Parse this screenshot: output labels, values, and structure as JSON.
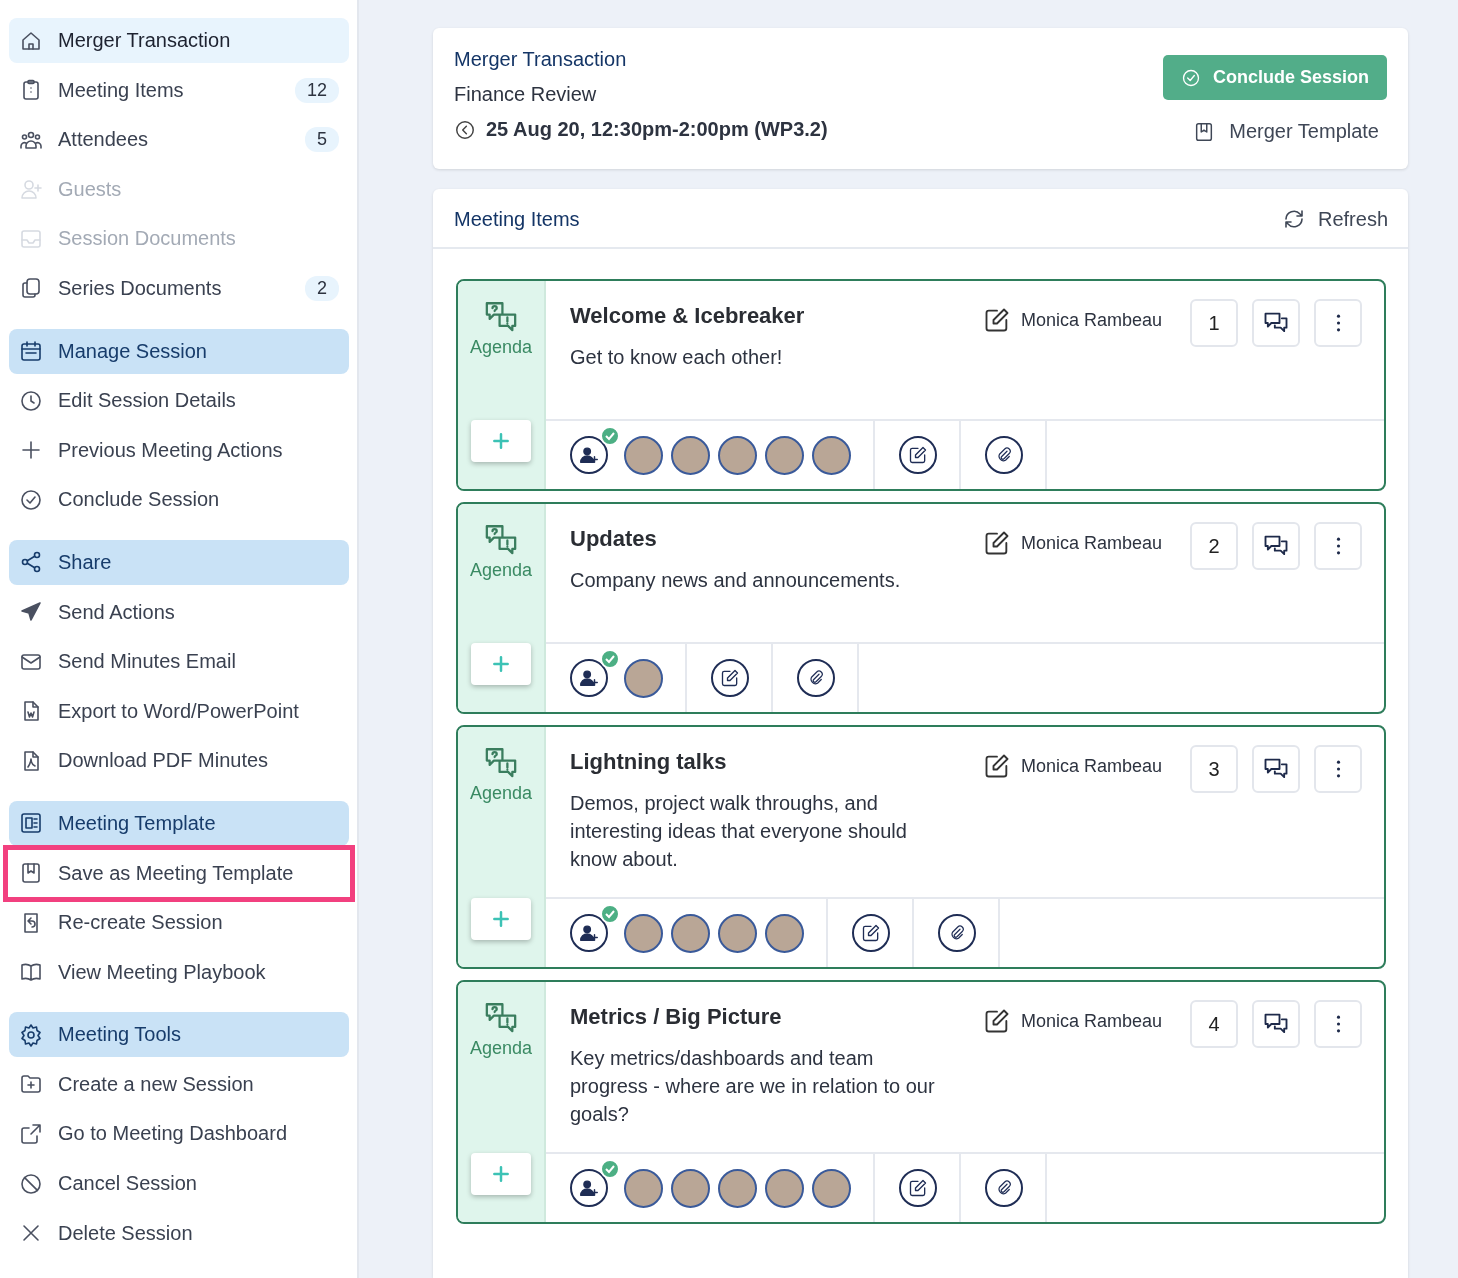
{
  "sidebar": {
    "items": [
      {
        "kind": "title",
        "label": "Merger Transaction",
        "highlighted": false
      },
      {
        "kind": "item",
        "label": "Meeting Items",
        "count": "12",
        "disabled": false,
        "highlighted": false
      },
      {
        "kind": "item",
        "label": "Attendees",
        "count": "5",
        "disabled": false,
        "highlighted": false
      },
      {
        "kind": "item",
        "label": "Guests",
        "disabled": true,
        "highlighted": false
      },
      {
        "kind": "item",
        "label": "Session Documents",
        "disabled": true,
        "highlighted": false
      },
      {
        "kind": "item",
        "label": "Series Documents",
        "count": "2",
        "disabled": false,
        "highlighted": false
      },
      {
        "kind": "header",
        "label": "Manage Session",
        "highlighted": false
      },
      {
        "kind": "item",
        "label": "Edit Session Details",
        "disabled": false,
        "highlighted": false
      },
      {
        "kind": "item",
        "label": "Previous Meeting Actions",
        "disabled": false,
        "highlighted": false
      },
      {
        "kind": "item",
        "label": "Conclude Session",
        "disabled": false,
        "highlighted": false
      },
      {
        "kind": "header",
        "label": "Share",
        "highlighted": false
      },
      {
        "kind": "item",
        "label": "Send Actions",
        "disabled": false,
        "highlighted": false
      },
      {
        "kind": "item",
        "label": "Send Minutes Email",
        "disabled": false,
        "highlighted": false
      },
      {
        "kind": "item",
        "label": "Export to Word/PowerPoint",
        "disabled": false,
        "highlighted": false
      },
      {
        "kind": "item",
        "label": "Download PDF Minutes",
        "disabled": false,
        "highlighted": false
      },
      {
        "kind": "header",
        "label": "Meeting Template",
        "highlighted": false
      },
      {
        "kind": "item",
        "label": "Save as Meeting Template",
        "disabled": false,
        "highlighted": true
      },
      {
        "kind": "item",
        "label": "Re-create Session",
        "disabled": false,
        "highlighted": false
      },
      {
        "kind": "item",
        "label": "View Meeting Playbook",
        "disabled": false,
        "highlighted": false
      },
      {
        "kind": "header",
        "label": "Meeting Tools",
        "highlighted": false
      },
      {
        "kind": "item",
        "label": "Create a new Session",
        "disabled": false,
        "highlighted": false
      },
      {
        "kind": "item",
        "label": "Go to Meeting Dashboard",
        "disabled": false,
        "highlighted": false
      },
      {
        "kind": "item",
        "label": "Cancel Session",
        "disabled": false,
        "highlighted": false
      },
      {
        "kind": "item",
        "label": "Delete Session",
        "disabled": false,
        "highlighted": false
      }
    ]
  },
  "session": {
    "title": "Merger Transaction",
    "subtitle": "Finance Review",
    "datetime": "25 Aug 20, 12:30pm-2:00pm (WP3.2)",
    "conclude_button": "Conclude Session",
    "template_link": "Merger Template"
  },
  "meeting_items": {
    "title": "Meeting Items",
    "refresh": "Refresh",
    "items": [
      {
        "type": "Agenda",
        "title": "Welcome & Icebreaker",
        "description": "Get to know each other!",
        "author": "Monica Rambeau",
        "number": "1",
        "attendees": [
          {
            "kind": "photo"
          },
          {
            "kind": "photo"
          },
          {
            "kind": "photo"
          },
          {
            "kind": "photo"
          },
          {
            "kind": "photo"
          }
        ]
      },
      {
        "type": "Agenda",
        "title": "Updates",
        "description": "Company news and announcements.",
        "author": "Monica Rambeau",
        "number": "2",
        "attendees": [
          {
            "kind": "photo"
          }
        ]
      },
      {
        "type": "Agenda",
        "title": "Lightning talks",
        "description": "Demos, project walk throughs, and interesting ideas that everyone should know about.",
        "author": "Monica Rambeau",
        "number": "3",
        "attendees": [
          {
            "kind": "photo"
          },
          {
            "kind": "photo"
          },
          {
            "kind": "photo"
          },
          {
            "kind": "photo"
          }
        ]
      },
      {
        "type": "Agenda",
        "title": "Metrics / Big Picture",
        "description": "Key metrics/dashboards and team progress - where are we in relation to our goals?",
        "author": "Monica Rambeau",
        "number": "4",
        "attendees": [
          {
            "kind": "photo"
          },
          {
            "kind": "photo"
          },
          {
            "kind": "photo"
          },
          {
            "kind": "photo"
          },
          {
            "kind": "photo"
          }
        ]
      }
    ]
  }
}
